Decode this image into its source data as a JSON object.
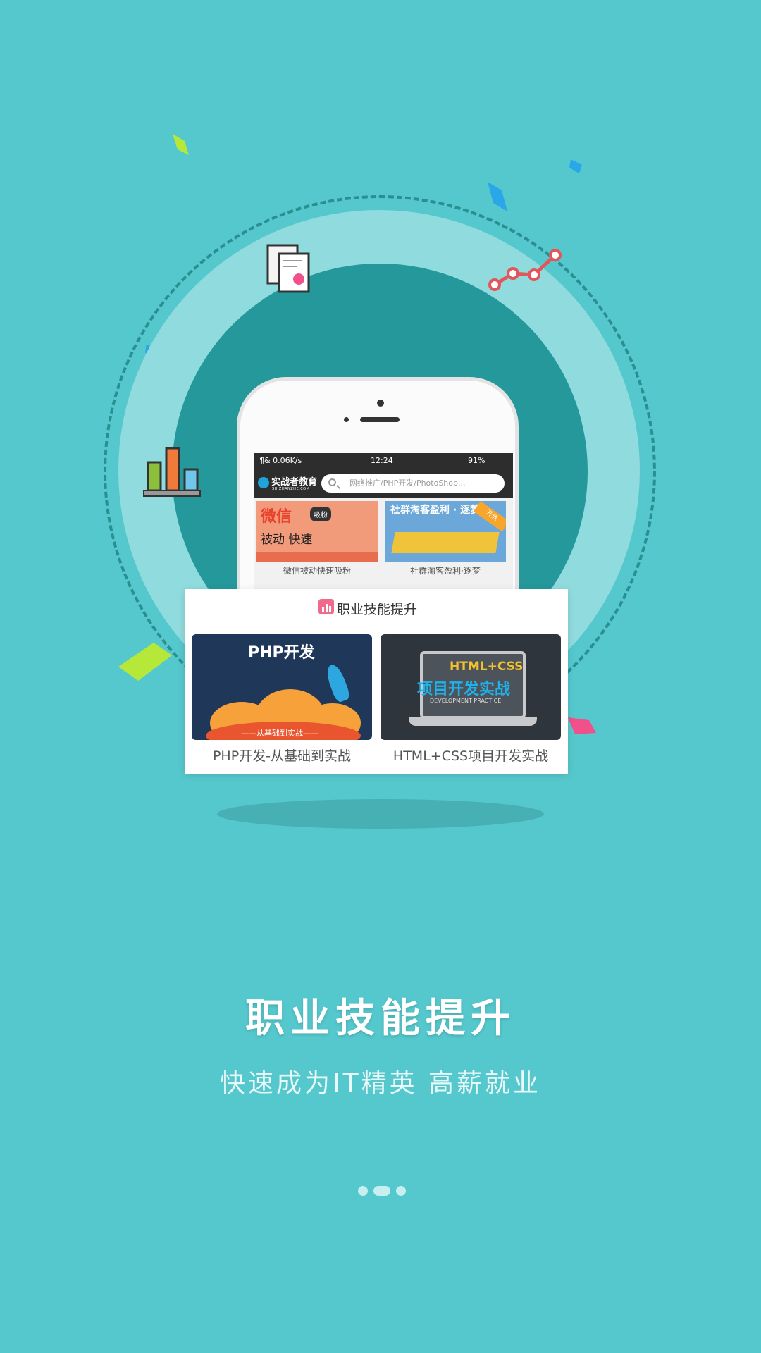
{
  "colors": {
    "background": "#55c8cd",
    "ring_dark": "#24989b",
    "ring_light": "#8fdbdd",
    "accent_pink": "#f16a8a"
  },
  "phone": {
    "status": {
      "left": "¶& 0.06K/s",
      "time": "12:24",
      "battery": "91%"
    },
    "logo": "实战者教育",
    "logo_sub": "SHIZHANZHE.COM",
    "search_placeholder": "网络推广/PHP开发/PhotoShop...",
    "cards": [
      {
        "img_big": "微信",
        "img_tag": "吸粉",
        "img_small": "被动 快速",
        "caption": "微信被动快速吸粉"
      },
      {
        "img_title": "社群淘客盈利 · 逐梦",
        "img_corner": "开放",
        "caption": "社群淘客盈利·逐梦"
      }
    ]
  },
  "panel": {
    "icon": "chart-icon",
    "title": "职业技能提升",
    "courses": [
      {
        "img_title": "PHP开发",
        "img_sub": "——从基础到实战——",
        "caption": "PHP开发-从基础到实战"
      },
      {
        "img_t1": "HTML+CSS",
        "img_t2": "项目开发实战",
        "img_t3": "DEVELOPMENT PRACTICE",
        "caption": "HTML+CSS项目开发实战"
      }
    ]
  },
  "headline": "职业技能提升",
  "subline": "快速成为IT精英 高薪就业",
  "pager": {
    "total": 3,
    "active": 1
  }
}
